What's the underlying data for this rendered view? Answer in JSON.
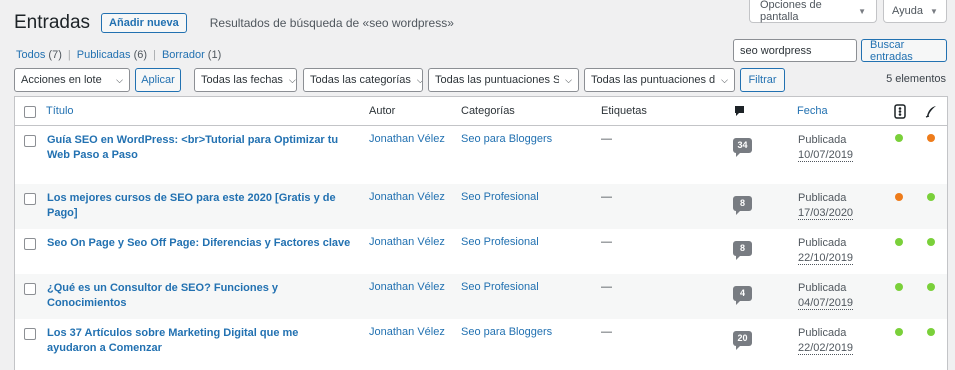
{
  "header": {
    "title": "Entradas",
    "add_new": "Añadir nueva",
    "subtitle": "Resultados de búsqueda de «seo wordpress»",
    "screen_options": "Opciones de pantalla",
    "help": "Ayuda"
  },
  "views": [
    {
      "label": "Todos",
      "count": "(7)"
    },
    {
      "label": "Publicadas",
      "count": "(6)"
    },
    {
      "label": "Borrador",
      "count": "(1)"
    }
  ],
  "search": {
    "value": "seo wordpress",
    "button": "Buscar entradas"
  },
  "filters": {
    "bulk_action": "Acciones en lote",
    "apply": "Aplicar",
    "dates": "Todas las fechas",
    "categories": "Todas las categorías",
    "scores_seo": "Todas las puntuaciones SEO",
    "scores_read": "Todas las puntuaciones de",
    "filter": "Filtrar"
  },
  "count_label": "5 elementos",
  "columns": {
    "title": "Título",
    "author": "Autor",
    "categories": "Categorías",
    "tags": "Etiquetas",
    "comments_icon": "comment-icon",
    "date": "Fecha",
    "seo_icon": "seo-score-icon",
    "readability_icon": "readability-icon"
  },
  "colors": {
    "green": "#7ad03a",
    "orange": "#ee7c1b",
    "link": "#2271b1"
  },
  "rows": [
    {
      "title": "Guía SEO en WordPress: <br>Tutorial para Optimizar tu Web Paso a Paso",
      "author": "Jonathan Vélez",
      "category": "Seo para Bloggers",
      "tags": "—",
      "comments": "34",
      "status": "Publicada",
      "date": "10/07/2019",
      "seo": "green",
      "readability": "orange"
    },
    {
      "title": "Los mejores cursos de SEO para este 2020 [Gratis y de Pago]",
      "author": "Jonathan Vélez",
      "category": "Seo Profesional",
      "tags": "—",
      "comments": "8",
      "status": "Publicada",
      "date": "17/03/2020",
      "seo": "orange",
      "readability": "green"
    },
    {
      "title": "Seo On Page y Seo Off Page: Diferencias y Factores clave",
      "author": "Jonathan Vélez",
      "category": "Seo Profesional",
      "tags": "—",
      "comments": "8",
      "status": "Publicada",
      "date": "22/10/2019",
      "seo": "green",
      "readability": "green"
    },
    {
      "title": "¿Qué es un Consultor de SEO? Funciones y Conocimientos",
      "author": "Jonathan Vélez",
      "category": "Seo Profesional",
      "tags": "—",
      "comments": "4",
      "status": "Publicada",
      "date": "04/07/2019",
      "seo": "green",
      "readability": "green"
    },
    {
      "title": "Los 37 Artículos sobre Marketing Digital que me ayudaron a Comenzar",
      "author": "Jonathan Vélez",
      "category": "Seo para Bloggers",
      "tags": "—",
      "comments": "20",
      "status": "Publicada",
      "date": "22/02/2019",
      "seo": "green",
      "readability": "green"
    }
  ]
}
